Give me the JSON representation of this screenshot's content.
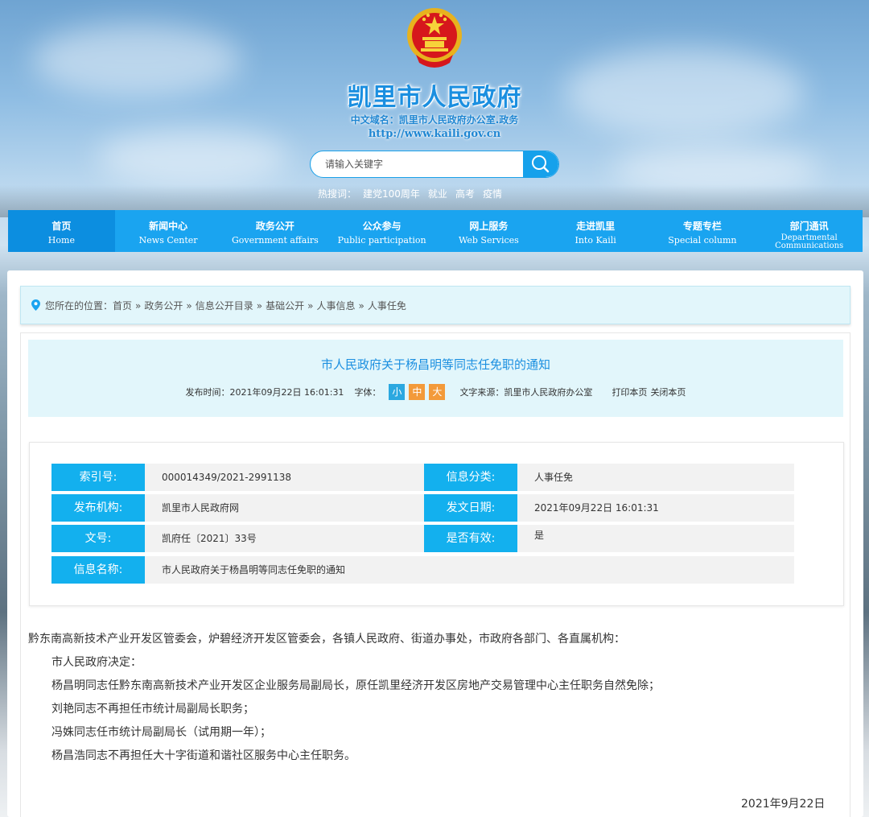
{
  "header": {
    "site_title": "凯里市人民政府",
    "domain_cn": "中文域名：凯里市人民政府办公室.政务",
    "url": "http://www.kaili.gov.cn",
    "emblem_icon": "national-emblem-icon"
  },
  "search": {
    "placeholder": "请输入关键字",
    "button_icon": "search-icon",
    "hot_label": "热搜词：",
    "hot_words": [
      "建党100周年",
      "就业",
      "高考",
      "疫情"
    ]
  },
  "nav": [
    {
      "cn": "首页",
      "en": "Home"
    },
    {
      "cn": "新闻中心",
      "en": "News Center"
    },
    {
      "cn": "政务公开",
      "en": "Government affairs"
    },
    {
      "cn": "公众参与",
      "en": "Public participation"
    },
    {
      "cn": "网上服务",
      "en": "Web Services"
    },
    {
      "cn": "走进凯里",
      "en": "Into Kaili"
    },
    {
      "cn": "专题专栏",
      "en": "Special column"
    },
    {
      "cn": "部门通讯",
      "en": "Departmental",
      "en2": "Communications"
    }
  ],
  "breadcrumb": {
    "prefix": "您所在的位置：",
    "items": [
      "首页",
      "政务公开",
      "信息公开目录",
      "基础公开",
      "人事信息",
      "人事任免"
    ],
    "sep": "»"
  },
  "article": {
    "title": "市人民政府关于杨昌明等同志任免职的通知",
    "publish_label": "发布时间：",
    "publish_time": "2021年09月22日 16:01:31",
    "font_label": "字体：",
    "font_small": "小",
    "font_mid": "中",
    "font_big": "大",
    "source_label": "文字来源：",
    "source": "凯里市人民政府办公室",
    "print": "打印本页",
    "close": "关闭本页"
  },
  "info": {
    "index_label": "索引号:",
    "index_value": "000014349/2021-2991138",
    "category_label": "信息分类:",
    "category_value": "人事任免",
    "org_label": "发布机构:",
    "org_value": "凯里市人民政府网",
    "date_label": "发文日期:",
    "date_value": "2021年09月22日 16:01:31",
    "doc_label": "文号:",
    "doc_value": "凯府任〔2021〕33号",
    "valid_label": "是否有效:",
    "valid_value": "是",
    "name_label": "信息名称:",
    "name_value": "市人民政府关于杨昌明等同志任免职的通知"
  },
  "body": {
    "address": "黔东南高新技术产业开发区管委会，炉碧经济开发区管委会，各镇人民政府、街道办事处，市政府各部门、各直属机构：",
    "paragraphs": [
      "市人民政府决定：",
      "杨昌明同志任黔东南高新技术产业开发区企业服务局副局长，原任凯里经济开发区房地产交易管理中心主任职务自然免除；",
      "刘艳同志不再担任市统计局副局长职务；",
      "冯姝同志任市统计局副局长（试用期一年）；",
      "杨昌浩同志不再担任大十字街道和谐社区服务中心主任职务。"
    ],
    "date": "2021年9月22日"
  }
}
